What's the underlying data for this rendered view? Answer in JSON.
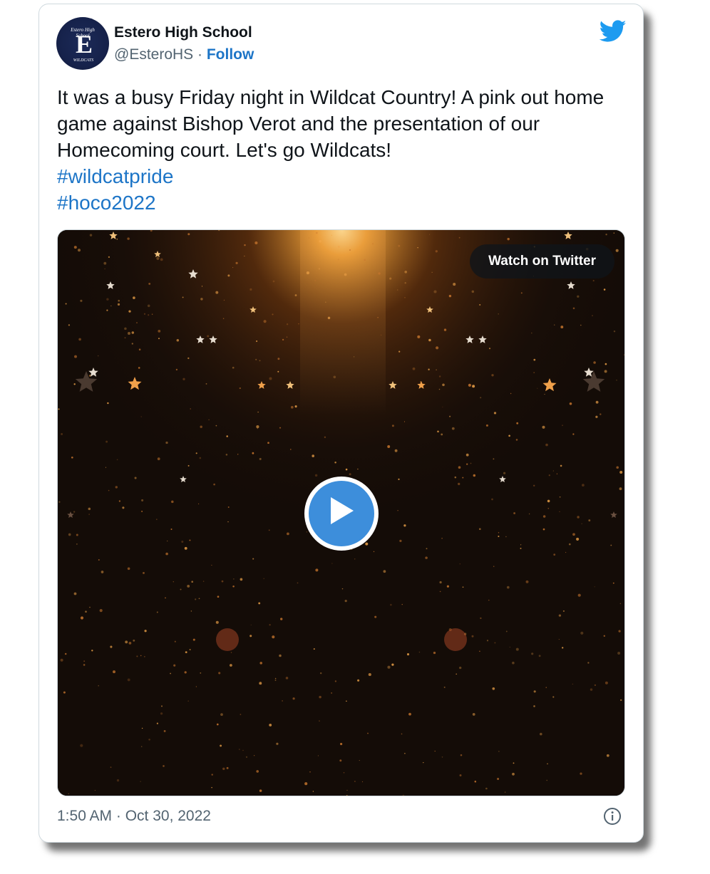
{
  "tweet": {
    "author_name": "Estero High School",
    "handle": "@EsteroHS",
    "separator": " · ",
    "follow_label": "Follow",
    "text": "It was a busy Friday night in Wildcat Country! A pink out home game against Bishop Verot and the presentation of our Homecoming court. Let's go Wildcats!",
    "hashtags": [
      "#wildcatpride",
      "#hoco2022"
    ],
    "timestamp": "1:50 AM · Oct 30, 2022"
  },
  "avatar": {
    "top_text": "Estero High School",
    "letter": "E",
    "bottom_text": "WILDCATS"
  },
  "media": {
    "watch_label": "Watch on Twitter",
    "play_icon": "play-icon"
  },
  "icons": {
    "brand": "twitter-bird-icon",
    "info": "info-icon"
  },
  "colors": {
    "link": "#1d75c7",
    "text": "#0f1419",
    "muted": "#536471",
    "twitter_blue": "#1d9bf0",
    "play_blue": "#3d8edb"
  }
}
